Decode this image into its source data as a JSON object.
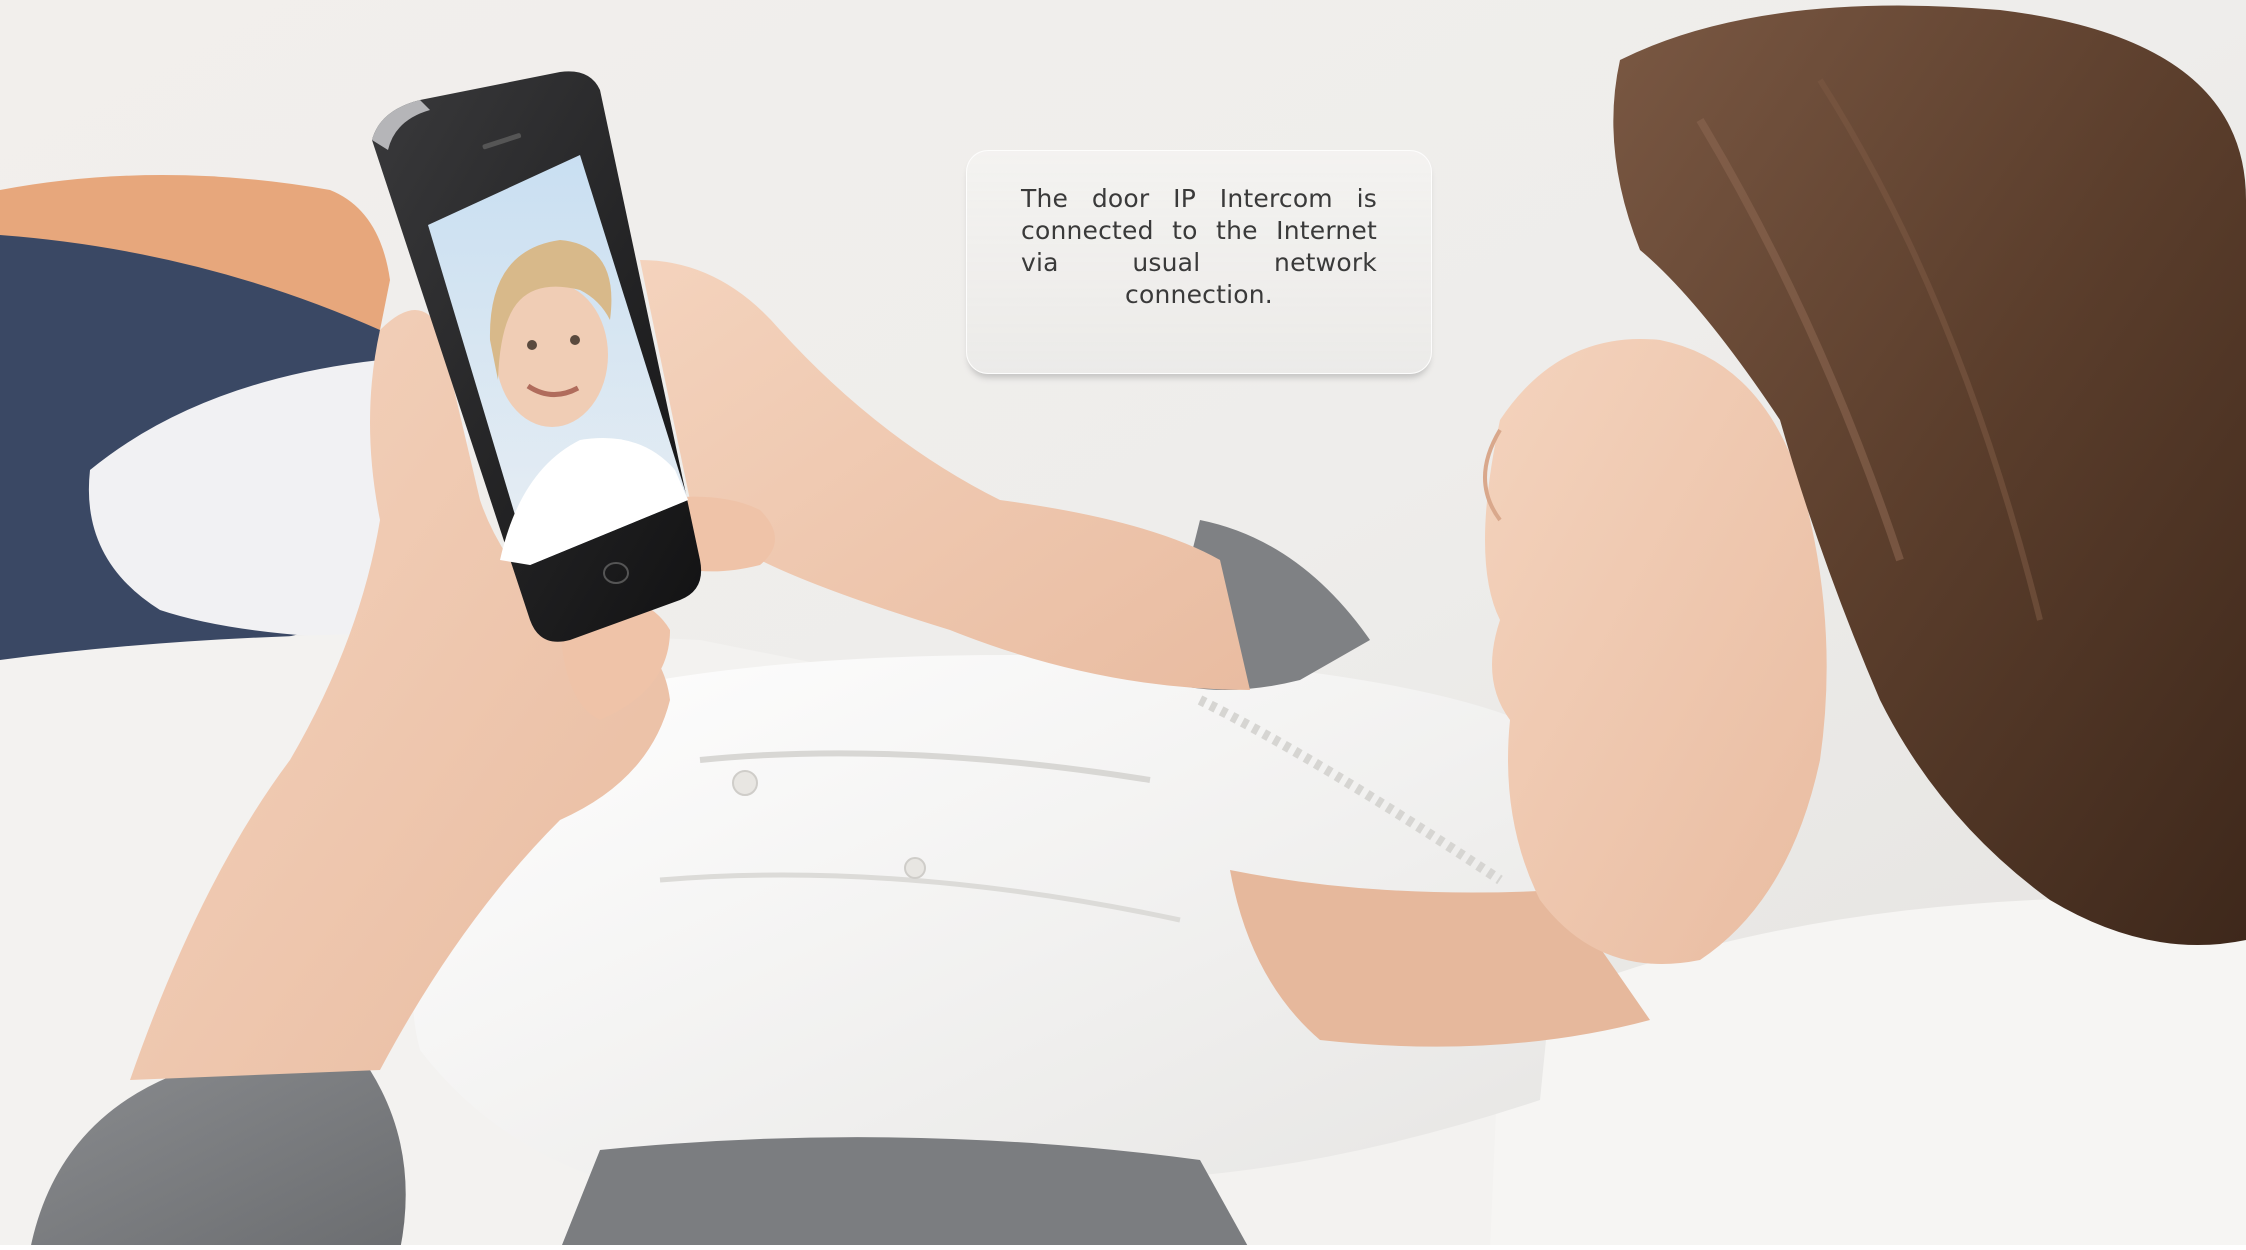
{
  "callout": {
    "text": "The door IP Intercom is connected to the Internet via usual network connection."
  },
  "colors": {
    "background": "#ebe9e6",
    "text": "#3a3a3a",
    "hair": "#5b3e2c",
    "sweater": "#7b7d80",
    "shirt": "#f3f2f0",
    "skin": "#f0c9b0",
    "pillow_blue": "#3a4864"
  }
}
